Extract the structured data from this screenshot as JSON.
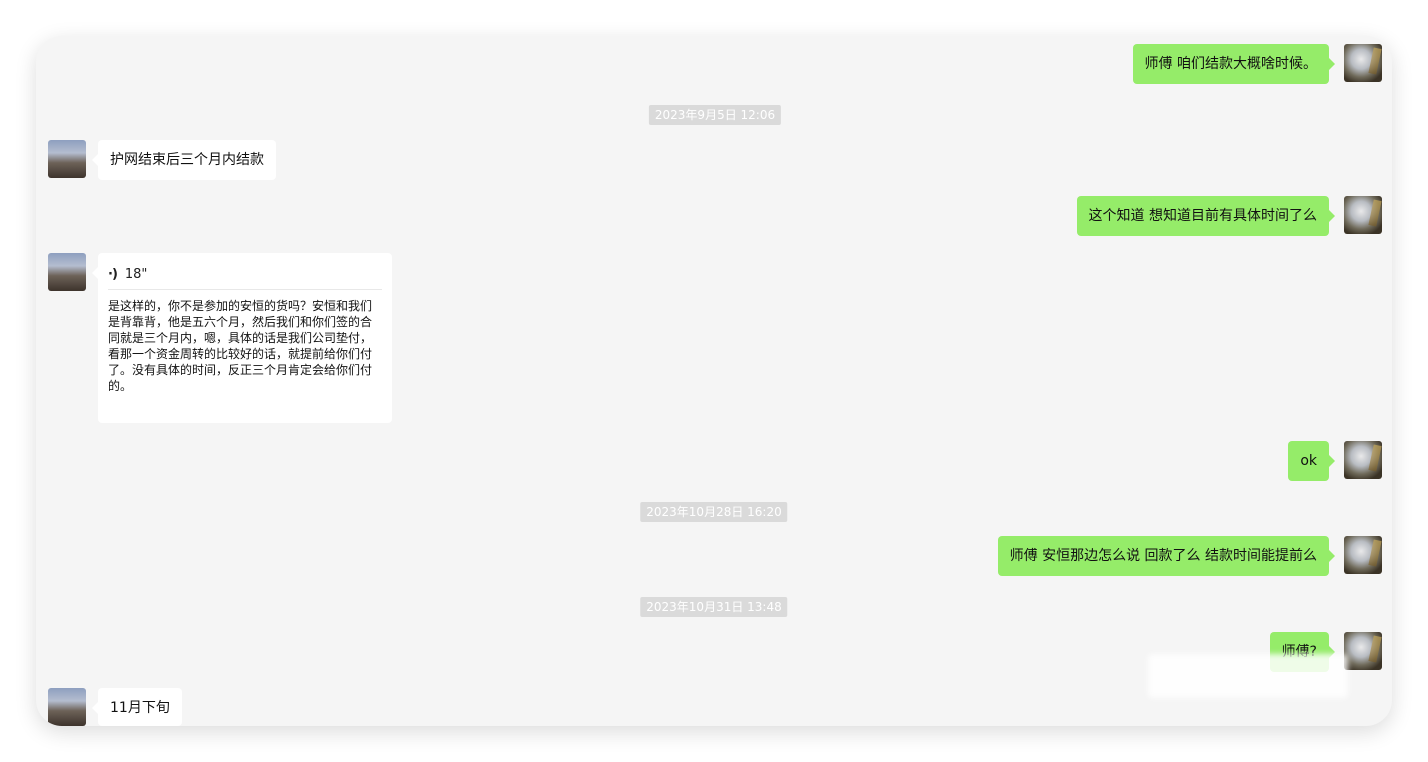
{
  "timestamps": {
    "t1": "2023年9月5日 12:06",
    "t2": "2023年10月28日 16:20",
    "t3": "2023年10月31日 13:48"
  },
  "messages": {
    "m1": "师傅 咱们结款大概啥时候。",
    "m2": "护网结束后三个月内结款",
    "m3": "这个知道 想知道目前有具体时间了么",
    "m4_voice_duration": "18\"",
    "m4_transcript": "是这样的，你不是参加的安恒的货吗？安恒和我们是背靠背，他是五六个月，然后我们和你们签的合同就是三个月内，嗯，具体的话是我们公司垫付，看那一个资金周转的比较好的话，就提前给你们付了。没有具体的时间，反正三个月肯定会给你们付的。",
    "m5": "ok",
    "m6": "师傅 安恒那边怎么说 回款了么 结款时间能提前么",
    "m7": "师傅?",
    "m8": "11月下旬"
  },
  "icons": {
    "voice": "voice-wave-icon"
  },
  "colors": {
    "background": "#f5f5f5",
    "outgoing_bubble": "#95ec69",
    "incoming_bubble": "#ffffff",
    "timestamp_bg": "#dadada"
  }
}
